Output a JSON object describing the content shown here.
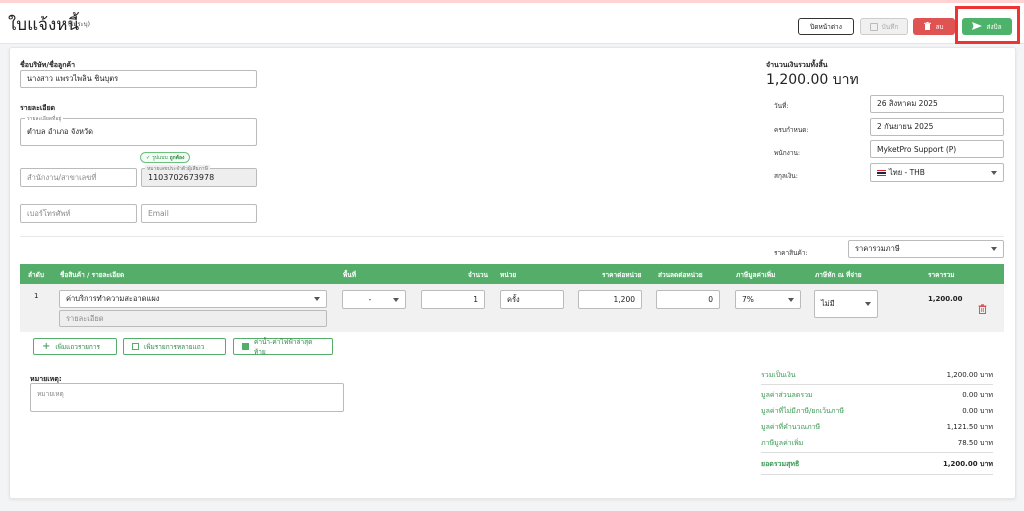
{
  "header": {
    "title": "ใบแจ้งหนี้",
    "subtitle": "(ไม่ระบุ)",
    "close_label": "ปิดหน้าต่าง",
    "save_label": "บันทึก",
    "delete_label": "ลบ",
    "send_label": "ส่งบิล",
    "colors": {
      "send": "#4db36b",
      "delete": "#e05353",
      "highlight": "#e33333"
    }
  },
  "customer": {
    "section_label": "ชื่อบริษัท/ชื่อลูกค้า",
    "name": "นางสาว แพรวไพลิน ชินบุตร",
    "detail_section_label": "รายละเอียด",
    "address_float_label": "รายละเอียดที่อยู่",
    "address": "ตำบล อำเภอ จังหวัด",
    "verified_badge_text": "รูปแบบ",
    "verified_badge_status": "ถูกต้อง",
    "branch_placeholder": "สำนักงาน/สาขาเลขที่",
    "tax_id_float_label": "หมายเลขประจำตัวผู้เสียภาษี",
    "tax_id": "1103702673978",
    "phone_placeholder": "เบอร์โทรศัพท์",
    "email_placeholder": "Email"
  },
  "summary_top": {
    "total_label": "จำนวนเงินรวมทั้งสิ้น",
    "total_value": "1,200.00 บาท",
    "date_label": "วันที่:",
    "date_value": "26 สิงหาคม 2025",
    "due_label": "ครบกำหนด:",
    "due_value": "2 กันยายน 2025",
    "staff_label": "พนักงาน:",
    "staff_value": "MyketPro Support (P)",
    "currency_label": "สกุลเงิน:",
    "currency_value": "ไทย - THB",
    "price_type_label": "ราคาสินค้า:",
    "price_type_value": "ราคารวมภาษี"
  },
  "table": {
    "headers": [
      "ลำดับ",
      "ชื่อสินค้า / รายละเอียด",
      "พื้นที่",
      "จำนวน",
      "หน่วย",
      "ราคาต่อหน่วย",
      "ส่วนลดต่อหน่วย",
      "ภาษีมูลค่าเพิ่ม",
      "ภาษีหัก ณ ที่จ่าย",
      "ราคารวม"
    ],
    "row": {
      "index": "1",
      "product": "ค่าบริการทำความสะอาดแผง",
      "detail_placeholder": "รายละเอียด",
      "area": "-",
      "qty": "1",
      "unit": "ครั้ง",
      "unit_price": "1,200",
      "discount": "0",
      "vat": "7%",
      "wht": "ไม่มี",
      "total": "1,200.00"
    }
  },
  "actions": {
    "add_row": "เพิ่มแถวรายการ",
    "add_multi": "เพิ่มรายการหลายแถว",
    "utility": "ค่าน้ำ-ค่าไฟฟ้าล่าสุดท้าย"
  },
  "notes": {
    "label": "หมายเหตุ:",
    "placeholder": "หมายเหตุ"
  },
  "totals": [
    {
      "label": "รวมเป็นเงิน",
      "value": "1,200.00 บาท"
    },
    {
      "label": "มูลค่าส่วนลดรวม",
      "value": "0.00 บาท"
    },
    {
      "label": "มูลค่าที่ไม่มีภาษี/ยกเว้นภาษี",
      "value": "0.00 บาท"
    },
    {
      "label": "มูลค่าที่คำนวณภาษี",
      "value": "1,121.50 บาท"
    },
    {
      "label": "ภาษีมูลค่าเพิ่ม",
      "value": "78.50 บาท"
    },
    {
      "label": "ยอดรวมสุทธิ",
      "value": "1,200.00 บาท"
    }
  ]
}
